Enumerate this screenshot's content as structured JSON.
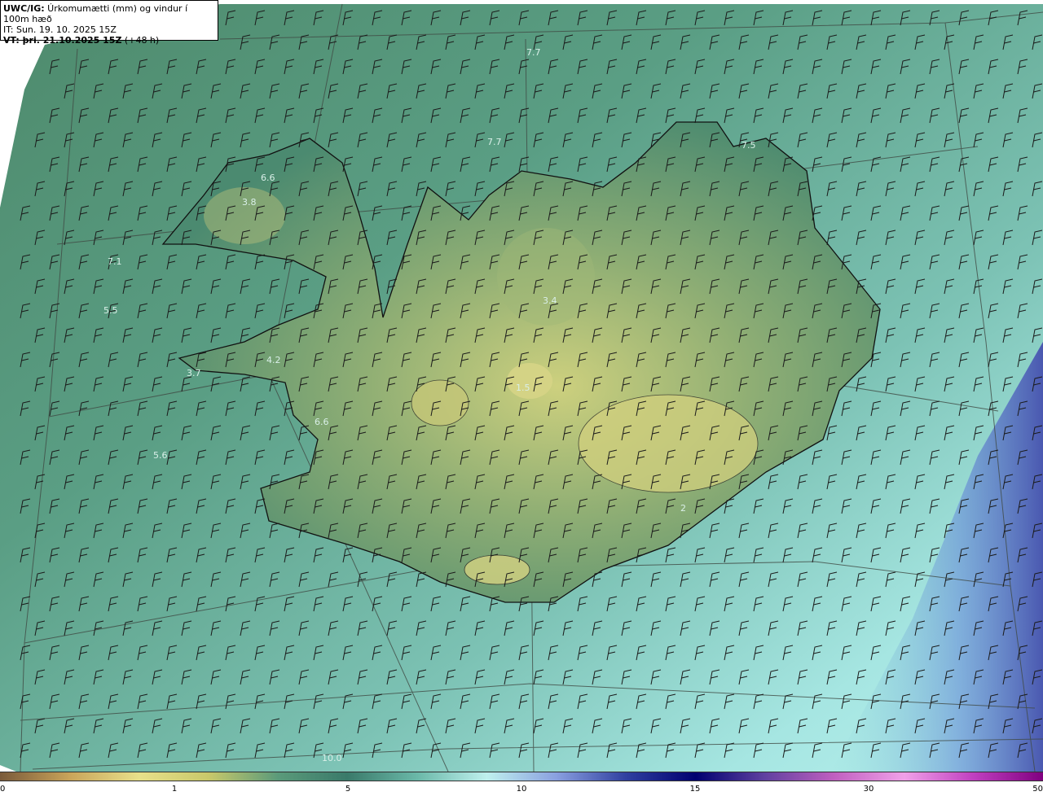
{
  "header": {
    "line1_bold": "UWC/IG:",
    "line1_rest": " Úrkomumætti (mm) og vindur í 100m hæð",
    "line2": "IT: Sun. 19. 10. 2025 15Z",
    "line3_bold": "VT: þri. 21.10.2025 15Z",
    "line3_rest": " (+48 h)"
  },
  "map_labels": [
    "7.7",
    "7.7",
    "7.5",
    "6.6",
    "3.8",
    "7.1",
    "5.5",
    "3.4",
    "4.2",
    "3.7",
    "6.6",
    "5.6",
    "10.0",
    "1.5",
    "2"
  ],
  "colorbar": {
    "ticks": [
      "0",
      "1",
      "5",
      "10",
      "15",
      "30",
      "50"
    ],
    "colors": [
      "#7a5a3a",
      "#c9a45a",
      "#e8e08a",
      "#c8c86a",
      "#5a9a7a",
      "#3a7a6a",
      "#6ab8a8",
      "#bff0ee",
      "#8aa0e0",
      "#3040a0",
      "#000070",
      "#6040a0",
      "#c060c0",
      "#f0a0e8",
      "#c040c0",
      "#800080"
    ]
  },
  "colors": {
    "sea": "#7fc4b6",
    "sea_deep": "#9ee0dc",
    "land_low": "#4f8d73",
    "land_high": "#c9cf7c",
    "coast": "#111111",
    "grid": "#444444"
  }
}
